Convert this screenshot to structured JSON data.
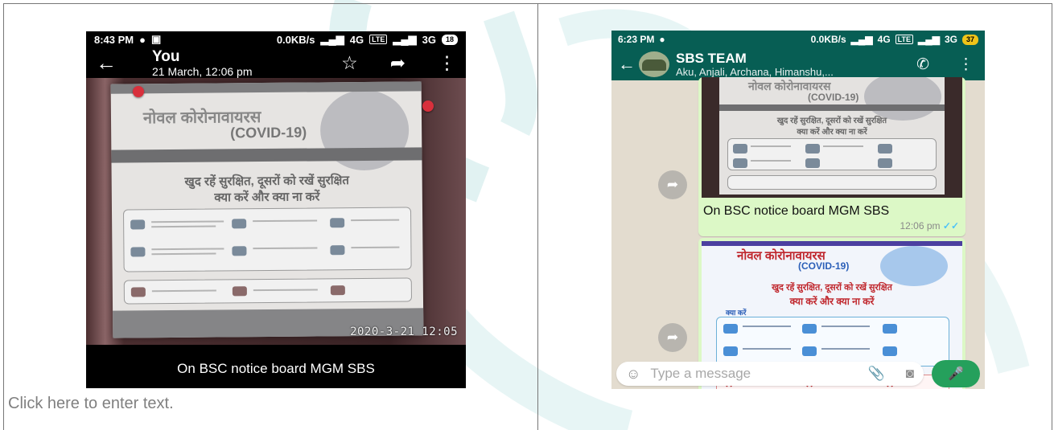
{
  "document": {
    "placeholder": "Click here to enter text."
  },
  "left_screenshot": {
    "status_bar": {
      "time": "8:43 PM",
      "network": "0.0KB/s",
      "carrier1": "4G",
      "carrier2": "3G",
      "volte": "LTE",
      "battery": "18"
    },
    "header": {
      "title": "You",
      "subtitle": "21 March, 12:06 pm"
    },
    "photo": {
      "timestamp": "2020-3-21 12:05",
      "poster_title_hindi": "नोवल कोरोनावायरस",
      "poster_covid": "(COVID-19)",
      "poster_line1": "खुद रहें सुरक्षित, दूसरों को रखें सुरक्षित",
      "poster_line2": "क्या करें और क्या ना करें"
    },
    "caption": "On BSC notice board MGM SBS"
  },
  "right_screenshot": {
    "status_bar": {
      "time": "6:23 PM",
      "network": "0.0KB/s",
      "carrier1": "4G",
      "carrier2": "3G",
      "volte": "LTE",
      "battery": "37"
    },
    "header": {
      "group_name": "SBS TEAM",
      "members": "Aku, Anjali, Archana, Himanshu,..."
    },
    "messages": [
      {
        "poster_title_hindi": "नोवल कोरोनावायरस",
        "poster_covid": "(COVID-19)",
        "poster_line1": "खुद रहें सुरक्षित, दूसरों को रखें सुरक्षित",
        "poster_line2": "क्या करें और क्या ना करें",
        "caption": "On BSC notice board MGM SBS",
        "time": "12:06 pm",
        "ticks": "✓✓"
      },
      {
        "poster_title_hindi": "नोवल कोरोनावायरस",
        "poster_covid": "(COVID-19)",
        "poster_line1": "खुद रहें सुरक्षित, दूसरों को रखें सुरक्षित",
        "poster_line2": "क्या करें और क्या ना करें",
        "poster_small": "क्या करें"
      }
    ],
    "input": {
      "placeholder": "Type a message"
    }
  },
  "colors": {
    "whatsapp_header": "#075e54",
    "bubble_out": "#dcf8c6",
    "mic_button": "#25a05c",
    "watermark": "#d6efef",
    "placeholder_text": "#808080"
  },
  "icons": [
    "back-arrow-icon",
    "star-icon",
    "share-icon",
    "more-icon",
    "call-add-icon",
    "forward-icon",
    "emoji-icon",
    "attach-icon",
    "camera-icon",
    "mic-icon",
    "chevron-down-icon"
  ]
}
